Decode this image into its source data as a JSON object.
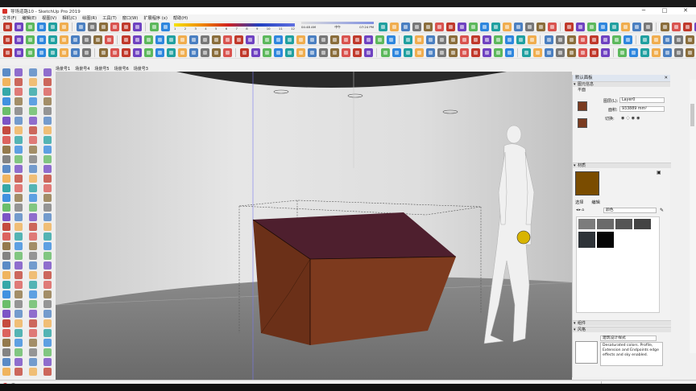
{
  "window": {
    "title": "导场道路10 - SketchUp Pro 2019",
    "buttons": [
      "─",
      "□",
      "✕"
    ]
  },
  "menu": [
    "文件(F)",
    "编辑(E)",
    "视图(V)",
    "相机(C)",
    "绘图(R)",
    "工具(T)",
    "窗口(W)",
    "扩展程序 (x)",
    "帮助(H)"
  ],
  "shadow": {
    "ticks": [
      "1",
      "2",
      "3",
      "4",
      "5",
      "6",
      "7",
      "8",
      "9",
      "10",
      "11",
      "12"
    ]
  },
  "time": {
    "start": "04:48 AM",
    "noon": "中午",
    "end": "07:24 PM"
  },
  "scene_tabs": [
    "场景号1",
    "场景号4",
    "场景号5",
    "场景号6",
    "场景号3"
  ],
  "tray": {
    "title": "默认面板",
    "entity_info": {
      "header": "图元信息",
      "type": "平面",
      "layer_label": "图层(L):",
      "layer_value": "Layer0",
      "area_label": "面积:",
      "area_value": "933889 mm²",
      "toggle_label": "切换:"
    },
    "materials": {
      "header": "材质",
      "tab_select": "选择",
      "tab_edit": "编辑",
      "dropdown": "颜色",
      "swatches": [
        "#7c7c7c",
        "#6a6a6a",
        "#555555",
        "#444444",
        "#2e3338",
        "#050505"
      ]
    },
    "components": {
      "header": "组件"
    },
    "styles": {
      "header": "风格",
      "name": "建筑设计样式",
      "description": "Desaturated colors. Profile, Extension and Endpoints edge effects and sky enabled."
    }
  },
  "status": {
    "value_label": "数值"
  },
  "colors": {
    "box_front": "#7d3a1e",
    "box_side": "#6b3018",
    "box_top": "#4e1f2e",
    "floor": "#7a7a7a",
    "wall": "#dcdcdc"
  }
}
